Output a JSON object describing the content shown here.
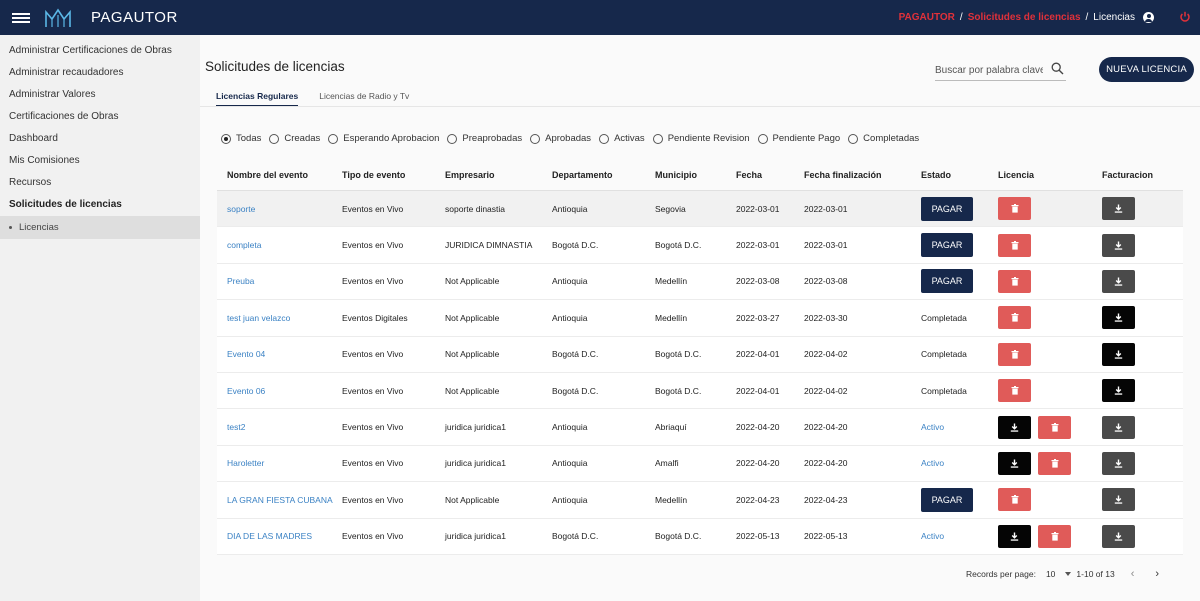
{
  "header": {
    "app_title": "PAGAUTOR",
    "breadcrumb": {
      "root": "PAGAUTOR",
      "section": "Solicitudes de licencias",
      "current": "Licencias"
    }
  },
  "sidebar": {
    "items": [
      {
        "label": "Administrar Certificaciones de Obras"
      },
      {
        "label": "Administrar recaudadores"
      },
      {
        "label": "Administrar Valores"
      },
      {
        "label": "Certificaciones de Obras"
      },
      {
        "label": "Dashboard"
      },
      {
        "label": "Mis Comisiones"
      },
      {
        "label": "Recursos"
      },
      {
        "label": "Solicitudes de licencias"
      }
    ],
    "sub_item": {
      "label": "Licencias"
    }
  },
  "main": {
    "title": "Solicitudes de licencias",
    "search": {
      "placeholder": "Buscar por palabra clave"
    },
    "new_button": "NUEVA LICENCIA",
    "tabs": [
      {
        "label": "Licencias Regulares"
      },
      {
        "label": "Licencias de Radio y Tv"
      }
    ],
    "filters": [
      {
        "label": "Todas"
      },
      {
        "label": "Creadas"
      },
      {
        "label": "Esperando Aprobacion"
      },
      {
        "label": "Preaprobadas"
      },
      {
        "label": "Aprobadas"
      },
      {
        "label": "Activas"
      },
      {
        "label": "Pendiente Revision"
      },
      {
        "label": "Pendiente Pago"
      },
      {
        "label": "Completadas"
      }
    ]
  },
  "table": {
    "headers": [
      "Nombre del evento",
      "Tipo de evento",
      "Empresario",
      "Departamento",
      "Municipio",
      "Fecha",
      "Fecha finalización",
      "Estado",
      "Licencia",
      "Facturacion"
    ],
    "pay_label": "PAGAR",
    "rows": [
      {
        "name": "soporte",
        "type": "Eventos en Vivo",
        "empresario": "soporte dinastia",
        "departamento": "Antioquia",
        "municipio": "Segovia",
        "fecha": "2022-03-01",
        "fecha_fin": "2022-03-01",
        "estado": "PAGAR",
        "licencia": "delete",
        "facturacion": "gray"
      },
      {
        "name": "completa",
        "type": "Eventos en Vivo",
        "empresario": "JURIDICA DIMNASTIA",
        "departamento": "Bogotá D.C.",
        "municipio": "Bogotá D.C.",
        "fecha": "2022-03-01",
        "fecha_fin": "2022-03-01",
        "estado": "PAGAR",
        "licencia": "delete",
        "facturacion": "gray"
      },
      {
        "name": "Preuba",
        "type": "Eventos en Vivo",
        "empresario": "Not Applicable",
        "departamento": "Antioquia",
        "municipio": "Medellín",
        "fecha": "2022-03-08",
        "fecha_fin": "2022-03-08",
        "estado": "PAGAR",
        "licencia": "delete",
        "facturacion": "gray"
      },
      {
        "name": "test juan velazco",
        "type": "Eventos Digitales",
        "empresario": "Not Applicable",
        "departamento": "Antioquia",
        "municipio": "Medellín",
        "fecha": "2022-03-27",
        "fecha_fin": "2022-03-30",
        "estado": "Completada",
        "licencia": "delete",
        "facturacion": "black"
      },
      {
        "name": "Evento 04",
        "type": "Eventos en Vivo",
        "empresario": "Not Applicable",
        "departamento": "Bogotá D.C.",
        "municipio": "Bogotá D.C.",
        "fecha": "2022-04-01",
        "fecha_fin": "2022-04-02",
        "estado": "Completada",
        "licencia": "delete",
        "facturacion": "black"
      },
      {
        "name": "Evento 06",
        "type": "Eventos en Vivo",
        "empresario": "Not Applicable",
        "departamento": "Bogotá D.C.",
        "municipio": "Bogotá D.C.",
        "fecha": "2022-04-01",
        "fecha_fin": "2022-04-02",
        "estado": "Completada",
        "licencia": "delete",
        "facturacion": "black"
      },
      {
        "name": "test2",
        "type": "Eventos en Vivo",
        "empresario": "juridica juridica1",
        "departamento": "Antioquia",
        "municipio": "Abriaquí",
        "fecha": "2022-04-20",
        "fecha_fin": "2022-04-20",
        "estado": "Activo",
        "licencia": "download-delete",
        "facturacion": "gray"
      },
      {
        "name": "Haroletter",
        "type": "Eventos en Vivo",
        "empresario": "juridica juridica1",
        "departamento": "Antioquia",
        "municipio": "Amalfi",
        "fecha": "2022-04-20",
        "fecha_fin": "2022-04-20",
        "estado": "Activo",
        "licencia": "download-delete",
        "facturacion": "gray"
      },
      {
        "name": "LA GRAN FIESTA CUBANA",
        "type": "Eventos en Vivo",
        "empresario": "Not Applicable",
        "departamento": "Antioquia",
        "municipio": "Medellín",
        "fecha": "2022-04-23",
        "fecha_fin": "2022-04-23",
        "estado": "PAGAR",
        "licencia": "delete",
        "facturacion": "gray"
      },
      {
        "name": "DIA DE LAS MADRES",
        "type": "Eventos en Vivo",
        "empresario": "juridica juridica1",
        "departamento": "Bogotá D.C.",
        "municipio": "Bogotá D.C.",
        "fecha": "2022-05-13",
        "fecha_fin": "2022-05-13",
        "estado": "Activo",
        "licencia": "download-delete",
        "facturacion": "gray"
      }
    ]
  },
  "pagination": {
    "label": "Records per page:",
    "per_page": "10",
    "range": "1-10 of 13"
  },
  "colors": {
    "navy": "#16284b",
    "accent_red": "#e0313a",
    "delete_red": "#e05b59",
    "link_blue": "#3b82c4"
  },
  "icons": [
    "menu-icon",
    "logo-icon",
    "user-icon",
    "power-icon",
    "search-icon",
    "trash-icon",
    "download-icon",
    "chevron-left-icon",
    "chevron-right-icon"
  ]
}
